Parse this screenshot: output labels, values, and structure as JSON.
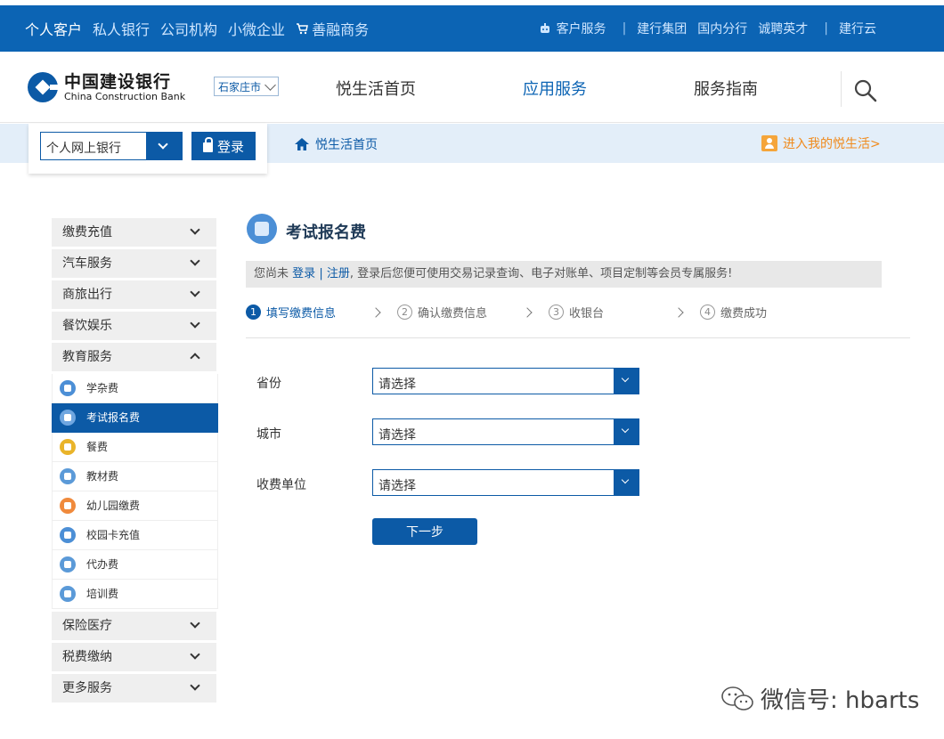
{
  "topbar": {
    "tabs": [
      "个人客户",
      "私人银行",
      "公司机构",
      "小微企业",
      "善融商务"
    ],
    "links": [
      "客户服务",
      "建行集团",
      "国内分行",
      "诚聘英才",
      "建行云"
    ]
  },
  "header": {
    "logo_cn": "中国建设银行",
    "logo_en": "China Construction Bank",
    "city": "石家庄市",
    "nav": [
      "悦生活首页",
      "应用服务",
      "服务指南"
    ]
  },
  "login": {
    "bank_select": "个人网上银行",
    "login_label": "登录"
  },
  "breadcrumb": {
    "home": "悦生活首页",
    "my_life": "进入我的悦生活>"
  },
  "sidebar": {
    "top_categories": [
      "缴费充值",
      "汽车服务",
      "商旅出行",
      "餐饮娱乐",
      "教育服务"
    ],
    "sub_items": [
      {
        "label": "学杂费",
        "color": "#4c8fd6"
      },
      {
        "label": "考试报名费",
        "color": "#6fa6e0"
      },
      {
        "label": "餐费",
        "color": "#e9b42a"
      },
      {
        "label": "教材费",
        "color": "#5b9ad8"
      },
      {
        "label": "幼儿园缴费",
        "color": "#f08a3c"
      },
      {
        "label": "校园卡充值",
        "color": "#4c8fd6"
      },
      {
        "label": "代办费",
        "color": "#5b9ad8"
      },
      {
        "label": "培训费",
        "color": "#5b9ad8"
      }
    ],
    "bottom_categories": [
      "保险医疗",
      "税费缴纳",
      "更多服务"
    ]
  },
  "main": {
    "title": "考试报名费",
    "notice_pre": "您尚未",
    "notice_login": "登录",
    "notice_sep": "|",
    "notice_register": "注册",
    "notice_post": ", 登录后您便可使用交易记录查询、电子对账单、项目定制等会员专属服务!",
    "steps": [
      {
        "num": "1",
        "label": "填写缴费信息"
      },
      {
        "num": "2",
        "label": "确认缴费信息"
      },
      {
        "num": "3",
        "label": "收银台"
      },
      {
        "num": "4",
        "label": "缴费成功"
      }
    ],
    "fields": [
      {
        "label": "省份",
        "value": "请选择"
      },
      {
        "label": "城市",
        "value": "请选择"
      },
      {
        "label": "收费单位",
        "value": "请选择"
      }
    ],
    "next_label": "下一步"
  },
  "watermark": "微信号: hbarts"
}
